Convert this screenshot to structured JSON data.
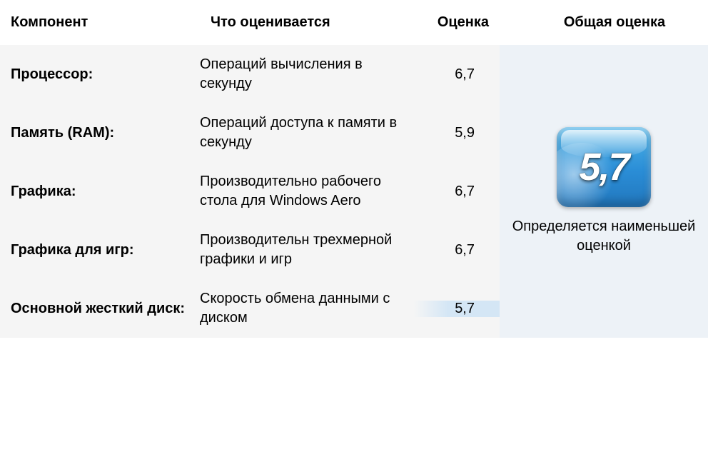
{
  "headers": {
    "component": "Компонент",
    "desc": "Что оценивается",
    "score": "Оценка",
    "overall": "Общая оценка"
  },
  "rows": [
    {
      "name": "Процессор:",
      "desc": "Операций вычисления в секунду",
      "score": "6,7",
      "lowest": false
    },
    {
      "name": "Память (RAM):",
      "desc": "Операций доступа к памяти в секунду",
      "score": "5,9",
      "lowest": false
    },
    {
      "name": "Графика:",
      "desc": "Производительно рабочего стола для Windows Aero",
      "score": "6,7",
      "lowest": false
    },
    {
      "name": "Графика для игр:",
      "desc": "Производительн трехмерной графики и игр",
      "score": "6,7",
      "lowest": false
    },
    {
      "name": "Основной жесткий диск:",
      "desc": "Скорость обмена данными с диском",
      "score": "5,7",
      "lowest": true
    }
  ],
  "overall": {
    "value": "5,7",
    "caption": "Определяется наименьшей оценкой"
  }
}
